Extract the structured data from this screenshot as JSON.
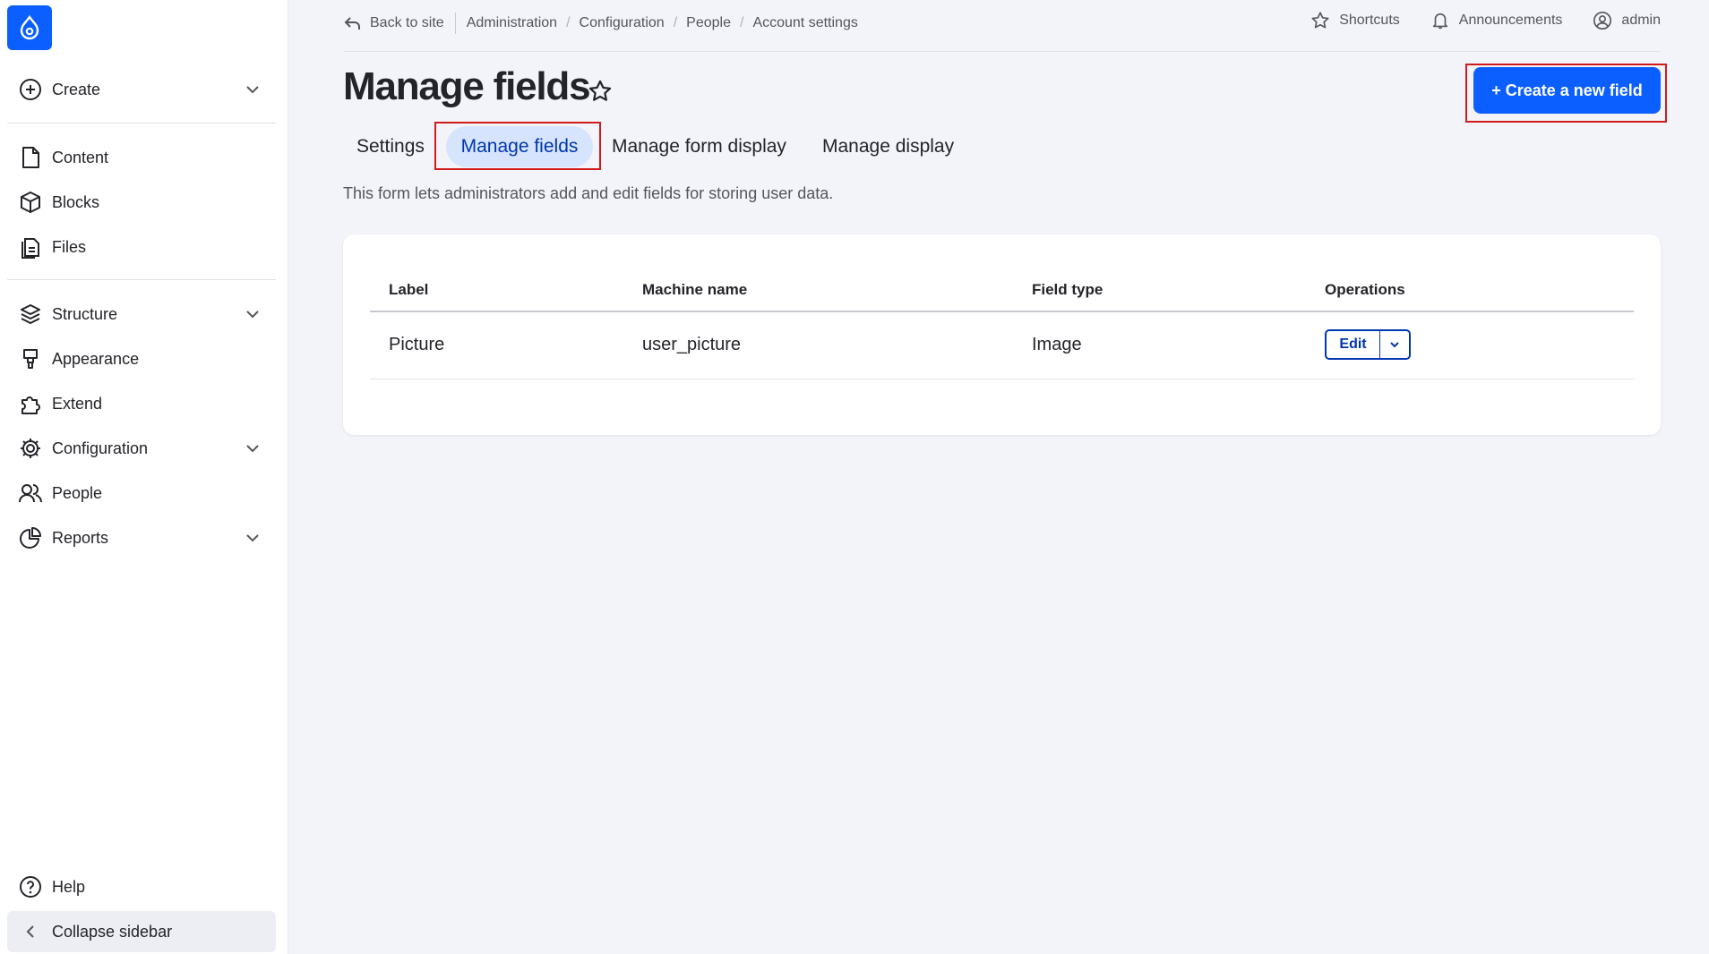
{
  "sidebar": {
    "items": [
      {
        "label": "Create",
        "icon": "plus-circle-icon"
      },
      {
        "label": "Content",
        "icon": "file-icon"
      },
      {
        "label": "Blocks",
        "icon": "cube-icon"
      },
      {
        "label": "Files",
        "icon": "files-icon"
      },
      {
        "label": "Structure",
        "icon": "layers-icon"
      },
      {
        "label": "Appearance",
        "icon": "brush-icon"
      },
      {
        "label": "Extend",
        "icon": "puzzle-icon"
      },
      {
        "label": "Configuration",
        "icon": "gear-icon"
      },
      {
        "label": "People",
        "icon": "people-icon"
      },
      {
        "label": "Reports",
        "icon": "pie-chart-icon"
      }
    ],
    "help_label": "Help",
    "collapse_label": "Collapse sidebar"
  },
  "topbar": {
    "back_label": "Back to site",
    "breadcrumbs": [
      "Administration",
      "Configuration",
      "People",
      "Account settings"
    ],
    "shortcuts_label": "Shortcuts",
    "announcements_label": "Announcements",
    "user_label": "admin"
  },
  "page": {
    "title": "Manage fields",
    "create_button_label": "+ Create a new field",
    "tabs": [
      "Settings",
      "Manage fields",
      "Manage form display",
      "Manage display"
    ],
    "active_tab": "Manage fields",
    "description": "This form lets administrators add and edit fields for storing user data."
  },
  "table": {
    "headers": [
      "Label",
      "Machine name",
      "Field type",
      "Operations"
    ],
    "rows": [
      {
        "label": "Picture",
        "machine_name": "user_picture",
        "field_type": "Image",
        "operation": "Edit"
      }
    ]
  },
  "colors": {
    "accent": "#0b5fff",
    "active_tab_bg": "#d7e4fd",
    "highlight_outline": "#d21a1a"
  }
}
